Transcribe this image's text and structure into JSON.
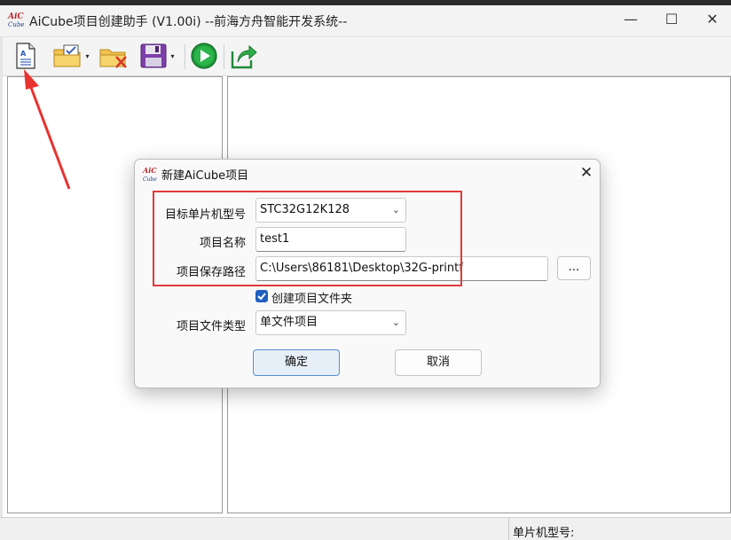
{
  "window": {
    "title": "AiCube项目创建助手 (V1.00i) --前海方舟智能开发系统--",
    "minimize": "—",
    "maximize": "☐",
    "close": "✕"
  },
  "toolbar": {
    "icons": [
      "new-project-icon",
      "open-project-icon",
      "close-project-icon",
      "save-icon",
      "run-icon",
      "export-icon"
    ],
    "dropdown": "▾"
  },
  "statusbar": {
    "mcu_label": "单片机型号:"
  },
  "dialog": {
    "logo_top": "AiC",
    "logo_bottom": "Cube",
    "title": "新建AiCube项目",
    "close": "✕",
    "mcu_label": "目标单片机型号",
    "mcu_value": "STC32G12K128",
    "name_label": "项目名称",
    "name_value": "test1",
    "path_label": "项目保存路径",
    "path_value": "C:\\Users\\86181\\Desktop\\32G-printf",
    "browse_label": "...",
    "create_folder_label": "创建项目文件夹",
    "create_folder_checked": true,
    "type_label": "项目文件类型",
    "type_value": "单文件项目",
    "ok_label": "确定",
    "cancel_label": "取消"
  },
  "colors": {
    "highlight_box": "#e03a3a",
    "annotation_arrow": "#e8332f",
    "checkbox": "#1f5fbf"
  }
}
